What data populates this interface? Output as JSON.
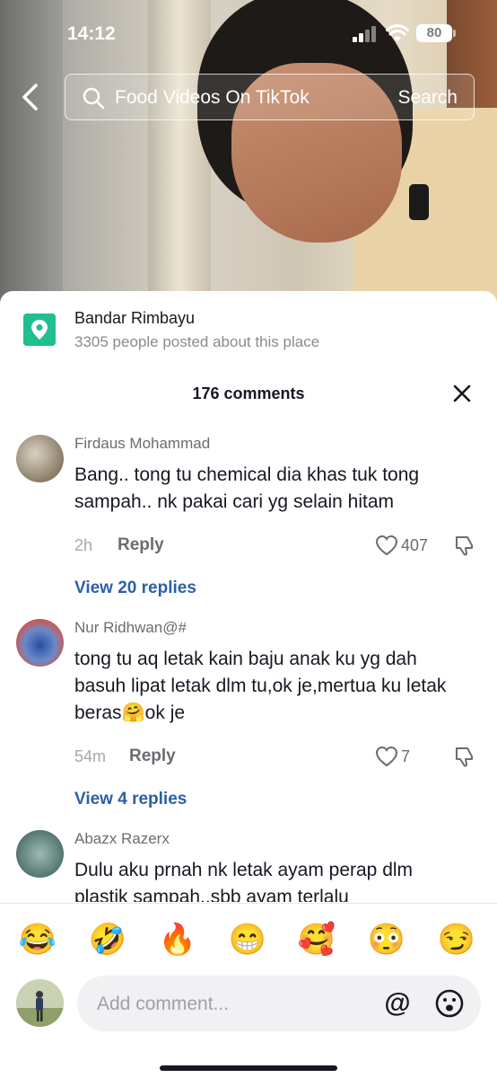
{
  "status_bar": {
    "time": "14:12",
    "battery": "80"
  },
  "search": {
    "query": "Food Videos On TikTok",
    "button": "Search"
  },
  "place": {
    "name": "Bandar Rimbayu",
    "subtitle": "3305 people posted about this place"
  },
  "comments_header": {
    "title": "176 comments"
  },
  "comments": [
    {
      "username": "Firdaus Mohammad",
      "text": "Bang.. tong tu chemical dia khas tuk tong sampah.. nk pakai cari yg selain hitam",
      "time": "2h",
      "reply_label": "Reply",
      "likes": "407",
      "view_replies": "View 20 replies"
    },
    {
      "username": "Nur Ridhwan@#",
      "text": "tong tu aq letak kain baju anak ku yg dah basuh lipat letak dlm tu,ok je,mertua ku letak beras🤗ok je",
      "time": "54m",
      "reply_label": "Reply",
      "likes": "7",
      "view_replies": "View 4 replies"
    },
    {
      "username": "Abazx Razerx",
      "text": "Dulu aku prnah nk letak ayam perap dlm plastik sampah..sbb ayam terlalu",
      "time": "",
      "reply_label": "",
      "likes": "",
      "view_replies": ""
    }
  ],
  "emojis": [
    "😂",
    "🤣",
    "🔥",
    "😁",
    "🥰",
    "😳",
    "😏"
  ],
  "composer": {
    "placeholder": "Add comment...",
    "at_symbol": "@"
  },
  "colors": {
    "place_icon": "#1fbf8f",
    "link_blue": "#2d5fa6",
    "input_bg": "#f1f1f3"
  }
}
